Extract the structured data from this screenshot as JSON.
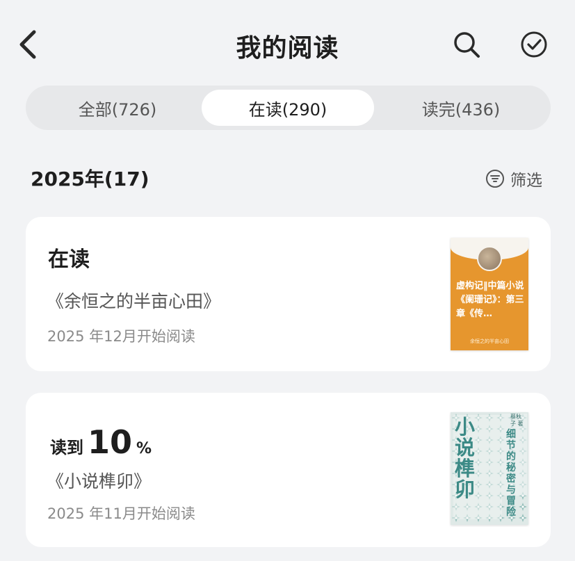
{
  "header": {
    "title": "我的阅读",
    "back_icon": "chevron-left-icon",
    "search_icon": "search-icon",
    "check_icon": "check-circle-icon"
  },
  "tabs": [
    {
      "label": "全部(726)",
      "active": false
    },
    {
      "label": "在读(290)",
      "active": true
    },
    {
      "label": "读完(436)",
      "active": false
    }
  ],
  "section": {
    "heading": "2025年(17)",
    "filter_label": "筛选",
    "filter_icon": "filter-icon"
  },
  "books": [
    {
      "status": "在读",
      "title": "《余恒之的半亩心田》",
      "start_date": "2025 年12月开始阅读",
      "cover": {
        "color": "#e6962e",
        "text": "虚构记‖中篇小说《阑珊记》：第三章《传…",
        "author": "余恒之的半亩心田"
      }
    },
    {
      "progress_prefix": "读到",
      "progress_value": "10",
      "progress_unit": "%",
      "progress_fraction": 0.1,
      "title": "《小说榫卯》",
      "start_date": "2025 年11月开始阅读",
      "cover": {
        "color": "#dfe9e7",
        "title_text": "小说榫卯",
        "side_text": "细节的秘密与冒险",
        "author": "蔡秋子 著"
      }
    }
  ]
}
